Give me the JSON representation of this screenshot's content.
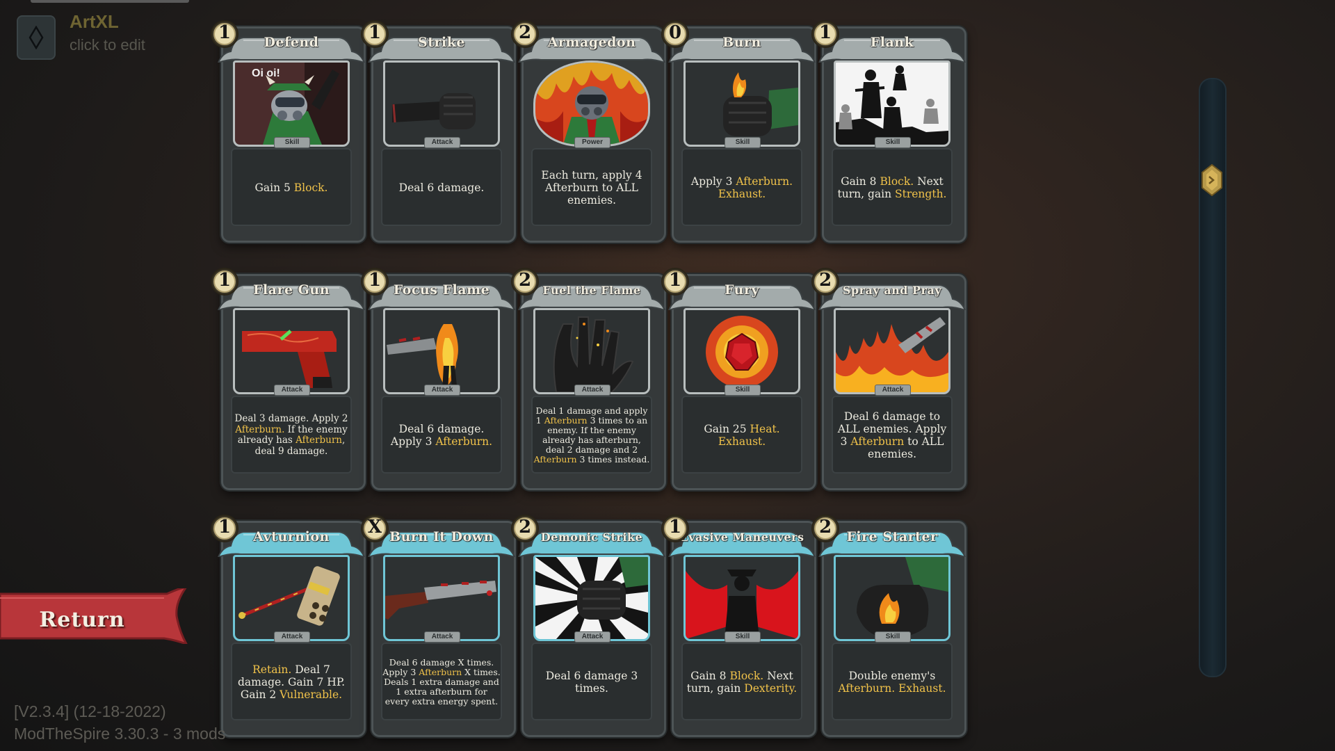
{
  "profile": {
    "name": "ArtXL",
    "edit_hint": "click to edit"
  },
  "colors": {
    "keyword": "#f0c24a",
    "common_banner": "#a3abab",
    "uncommon_banner": "#6fc6d6",
    "return_banner": "#b8363a"
  },
  "rows": [
    {
      "cards": [
        {
          "cost": "1",
          "title": "Defend",
          "type": "Skill",
          "art_caption": "Oi oi!",
          "art": "devil-gasmask-icon",
          "desc": [
            {
              "t": "Gain 5 "
            },
            {
              "t": "Block.",
              "k": 1
            }
          ]
        },
        {
          "cost": "1",
          "title": "Strike",
          "type": "Attack",
          "art": "fist-icon",
          "desc": [
            {
              "t": "Deal 6 damage."
            }
          ]
        },
        {
          "cost": "2",
          "title": "Armagedon",
          "type": "Power",
          "art": "gasmask-fire-icon",
          "desc": [
            {
              "t": "Each turn, apply 4 Afterburn to ALL enemies."
            }
          ]
        },
        {
          "cost": "0",
          "title": "Burn",
          "type": "Skill",
          "art": "burning-fist-icon",
          "desc": [
            {
              "t": "Apply 3 "
            },
            {
              "t": "Afterburn. Exhaust.",
              "k": 1
            }
          ]
        },
        {
          "cost": "1",
          "title": "Flank",
          "type": "Skill",
          "art": "silhouette-soldiers-icon",
          "desc": [
            {
              "t": "Gain 8 "
            },
            {
              "t": "Block.",
              "k": 1
            },
            {
              "t": " Next turn, gain "
            },
            {
              "t": "Strength.",
              "k": 1
            }
          ]
        }
      ]
    },
    {
      "cards": [
        {
          "cost": "1",
          "title": "Flare Gun",
          "type": "Attack",
          "art": "flare-gun-icon",
          "desc": [
            {
              "t": "Deal 3 damage. Apply 2 "
            },
            {
              "t": "Afterburn.",
              "k": 1
            },
            {
              "t": " If the enemy already has "
            },
            {
              "t": "Afterburn",
              "k": 1
            },
            {
              "t": ", deal 9 damage."
            }
          ]
        },
        {
          "cost": "1",
          "title": "Focus Flame",
          "type": "Attack",
          "art": "flamethrower-figure-icon",
          "desc": [
            {
              "t": "Deal 6 damage. Apply 3 "
            },
            {
              "t": "Afterburn.",
              "k": 1
            }
          ]
        },
        {
          "cost": "2",
          "title": "Fuel the Flame",
          "type": "Attack",
          "art": "burning-hand-icon",
          "desc": [
            {
              "t": "Deal 1 damage and apply 1 "
            },
            {
              "t": "Afterburn",
              "k": 1
            },
            {
              "t": " 3 times to an enemy. If the enemy already has afterburn, deal 2 damage and 2 "
            },
            {
              "t": "Afterburn",
              "k": 1
            },
            {
              "t": " 3 times instead."
            }
          ]
        },
        {
          "cost": "1",
          "title": "Fury",
          "type": "Skill",
          "art": "fire-gem-icon",
          "desc": [
            {
              "t": "Gain 25 "
            },
            {
              "t": "Heat. Exhaust.",
              "k": 1
            }
          ]
        },
        {
          "cost": "2",
          "title": "Spray and Pray",
          "type": "Attack",
          "art": "flamethrower-blaze-icon",
          "desc": [
            {
              "t": "Deal 6 damage to ALL enemies. Apply 3 "
            },
            {
              "t": "Afterburn",
              "k": 1
            },
            {
              "t": " to ALL enemies."
            }
          ]
        }
      ]
    },
    {
      "cards": [
        {
          "cost": "1",
          "title": "Avturnion",
          "type": "Attack",
          "art": "hammer-icon",
          "desc": [
            {
              "t": "Retain.",
              "k": 1
            },
            {
              "t": " Deal 7 damage. Gain 7 HP. Gain 2 "
            },
            {
              "t": "Vulnerable.",
              "k": 1
            }
          ]
        },
        {
          "cost": "X",
          "title": "Burn It Down",
          "type": "Attack",
          "art": "rifle-icon",
          "desc": [
            {
              "t": "Deal 6 damage X times. Apply 3 "
            },
            {
              "t": "Afterburn",
              "k": 1
            },
            {
              "t": " X times. Deals 1 extra damage and 1 extra afterburn for every extra energy spent."
            }
          ]
        },
        {
          "cost": "2",
          "title": "Demonic Strike",
          "type": "Attack",
          "art": "punch-burst-icon",
          "desc": [
            {
              "t": "Deal 6 damage 3 times."
            }
          ]
        },
        {
          "cost": "1",
          "title": "Evasive Maneuvers",
          "type": "Skill",
          "art": "winged-silhouette-icon",
          "desc": [
            {
              "t": "Gain 8 "
            },
            {
              "t": "Block.",
              "k": 1
            },
            {
              "t": " Next turn, gain "
            },
            {
              "t": "Dexterity.",
              "k": 1
            }
          ]
        },
        {
          "cost": "2",
          "title": "Fire Starter",
          "type": "Skill",
          "art": "fire-palm-icon",
          "desc": [
            {
              "t": "Double enemy's "
            },
            {
              "t": "Afterburn. Exhaust.",
              "k": 1
            }
          ]
        }
      ]
    }
  ],
  "return_label": "Return",
  "version": "[V2.3.4] (12-18-2022)",
  "mods": "ModTheSpire 3.30.3 - 3 mods"
}
